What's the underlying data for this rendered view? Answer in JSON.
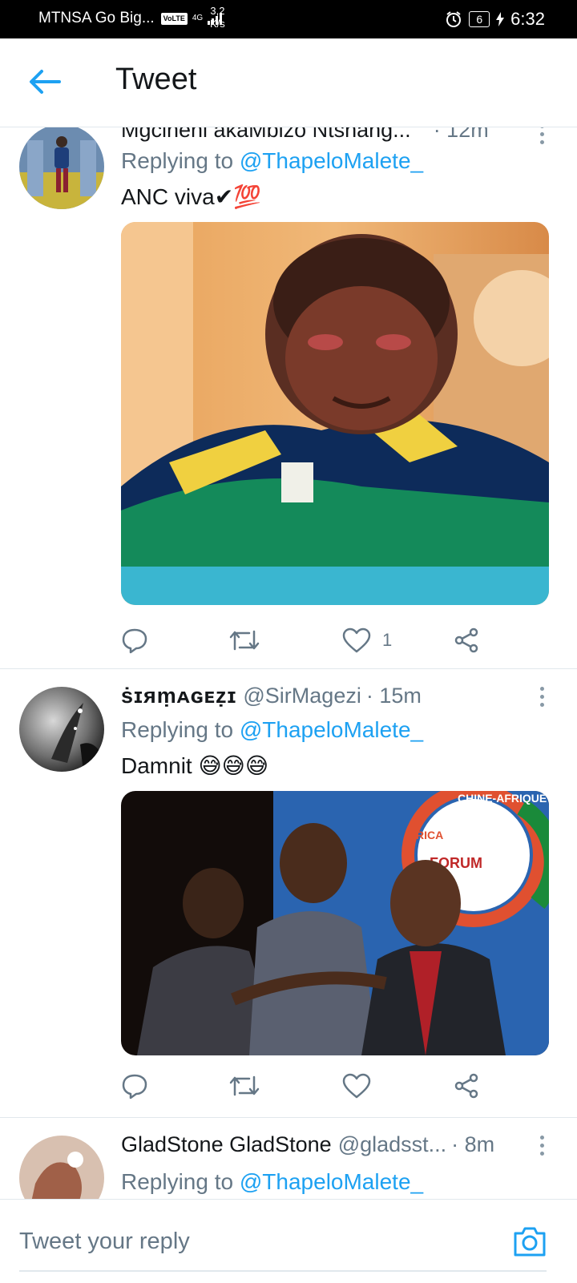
{
  "status_bar": {
    "carrier": "MTNSA Go Big...",
    "volte": "VoLTE",
    "network": "4G",
    "speed_value": "3,2",
    "speed_unit": "K/s",
    "battery": "6",
    "time": "6:32"
  },
  "header": {
    "title": "Tweet"
  },
  "tweets": [
    {
      "name": "Mgcineni akaMbizo Ntshang...",
      "handle": "",
      "time": "· 12m",
      "reply_prefix": "Replying to",
      "reply_to": "@ThapeloMalete_",
      "text": "ANC viva✔💯",
      "likes": "1"
    },
    {
      "name": "ṡɪᴙṃᴀɢᴇẓɪ",
      "handle": "@SirMagezi",
      "time": "· 15m",
      "reply_prefix": "Replying to",
      "reply_to": "@ThapeloMalete_",
      "text": "Damnit 😅😅😅",
      "likes": "",
      "media_banner": "CHINE-AFRIQUE",
      "media_forum": "FORUM",
      "media_rica": "RICA"
    },
    {
      "name": "GladStone GladStone",
      "handle": "@gladsst...",
      "time": "· 8m",
      "reply_prefix": "Replying to",
      "reply_to": "@ThapeloMalete_"
    }
  ],
  "composer": {
    "placeholder": "Tweet your reply"
  },
  "colors": {
    "accent": "#1da1f2",
    "secondary_text": "#657786",
    "divider": "#e1e8ed"
  }
}
